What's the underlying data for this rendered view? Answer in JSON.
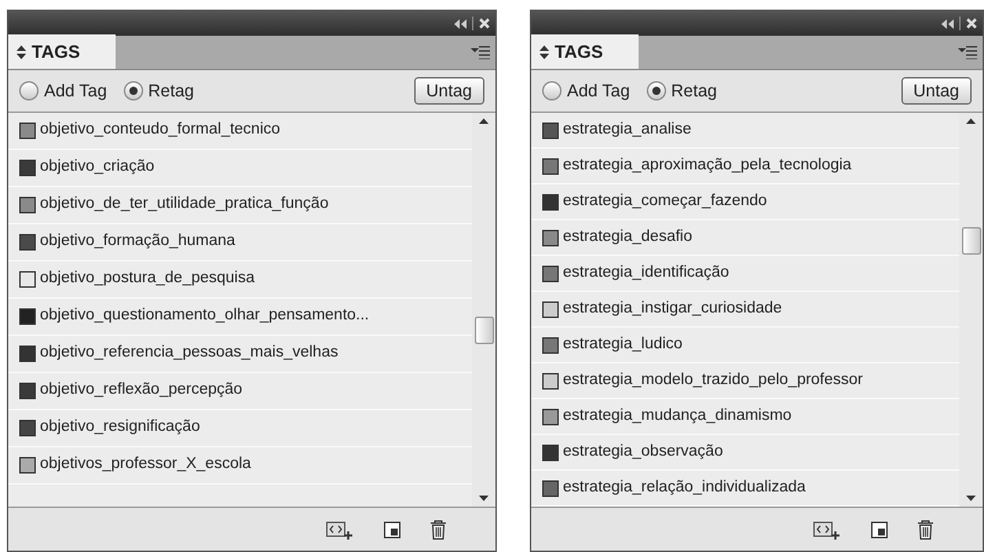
{
  "panels": [
    {
      "tab": "TAGS",
      "radios": [
        {
          "label": "Add Tag",
          "selected": false
        },
        {
          "label": "Retag",
          "selected": true
        }
      ],
      "button": "Untag",
      "tags": [
        {
          "name": "objetivo_conteudo_formal_tecnico",
          "color": "#8a8a8a"
        },
        {
          "name": "objetivo_criação",
          "color": "#3a3a3a"
        },
        {
          "name": "objetivo_de_ter_utilidade_pratica_função",
          "color": "#8a8a8a"
        },
        {
          "name": "objetivo_formação_humana",
          "color": "#4a4a4a"
        },
        {
          "name": "objetivo_postura_de_pesquisa",
          "color": "#e8e8e8"
        },
        {
          "name": "objetivo_questionamento_olhar_pensamento...",
          "color": "#222222"
        },
        {
          "name": "objetivo_referencia_pessoas_mais_velhas",
          "color": "#333333"
        },
        {
          "name": "objetivo_reflexão_percepção",
          "color": "#3a3a3a"
        },
        {
          "name": "objetivo_resignificação",
          "color": "#444444"
        },
        {
          "name": "objetivos_professor_X_escola",
          "color": "#aaaaaa"
        }
      ]
    },
    {
      "tab": "TAGS",
      "radios": [
        {
          "label": "Add Tag",
          "selected": false
        },
        {
          "label": "Retag",
          "selected": true
        }
      ],
      "button": "Untag",
      "tags": [
        {
          "name": "estrategia_analise",
          "color": "#555555"
        },
        {
          "name": "estrategia_aproximação_pela_tecnologia",
          "color": "#777777"
        },
        {
          "name": "estrategia_começar_fazendo",
          "color": "#333333"
        },
        {
          "name": "estrategia_desafio",
          "color": "#8a8a8a"
        },
        {
          "name": "estrategia_identificação",
          "color": "#777777"
        },
        {
          "name": "estrategia_instigar_curiosidade",
          "color": "#cccccc"
        },
        {
          "name": "estrategia_ludico",
          "color": "#777777"
        },
        {
          "name": "estrategia_modelo_trazido_pelo_professor",
          "color": "#cccccc"
        },
        {
          "name": "estrategia_mudança_dinamismo",
          "color": "#999999"
        },
        {
          "name": "estrategia_observação",
          "color": "#333333"
        },
        {
          "name": "estrategia_relação_individualizada",
          "color": "#666666"
        }
      ]
    }
  ]
}
